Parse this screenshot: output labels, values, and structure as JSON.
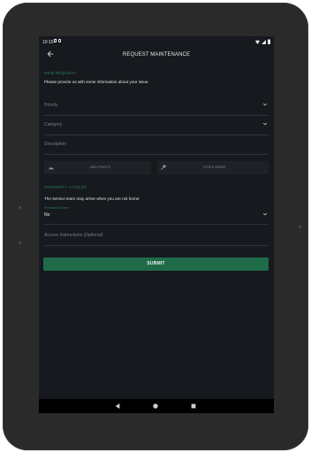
{
  "status": {
    "time": "10:15"
  },
  "header": {
    "title": "REQUEST MAINTENANCE"
  },
  "new_request": {
    "section_label": "NEW REQUEST",
    "intro": "Please provide us with some information about your issue.",
    "priority_placeholder": "Priority",
    "category_placeholder": "Category",
    "description_placeholder": "Description",
    "add_photo_label": "ADD PHOTO",
    "voice_memo_label": "VOICE MEMO"
  },
  "property_access": {
    "section_label": "PROPERTY ACCESS",
    "note": "The service team may arrive when you are not home:",
    "permission_label": "Permission to Enter",
    "permission_value": "No",
    "instructions_placeholder": "Access Instructions (Optional)"
  },
  "actions": {
    "submit_label": "SUBMIT"
  },
  "icons": {
    "back": "arrow-back-icon",
    "chevron": "chevron-down-icon",
    "photo": "image-icon",
    "mic": "microphone-icon",
    "nav_back": "nav-back-icon",
    "nav_home": "nav-home-icon",
    "nav_recents": "nav-recents-icon"
  },
  "colors": {
    "accent": "#2e7d59",
    "submit_bg": "#1f6a48",
    "screen_bg": "#16191d"
  }
}
